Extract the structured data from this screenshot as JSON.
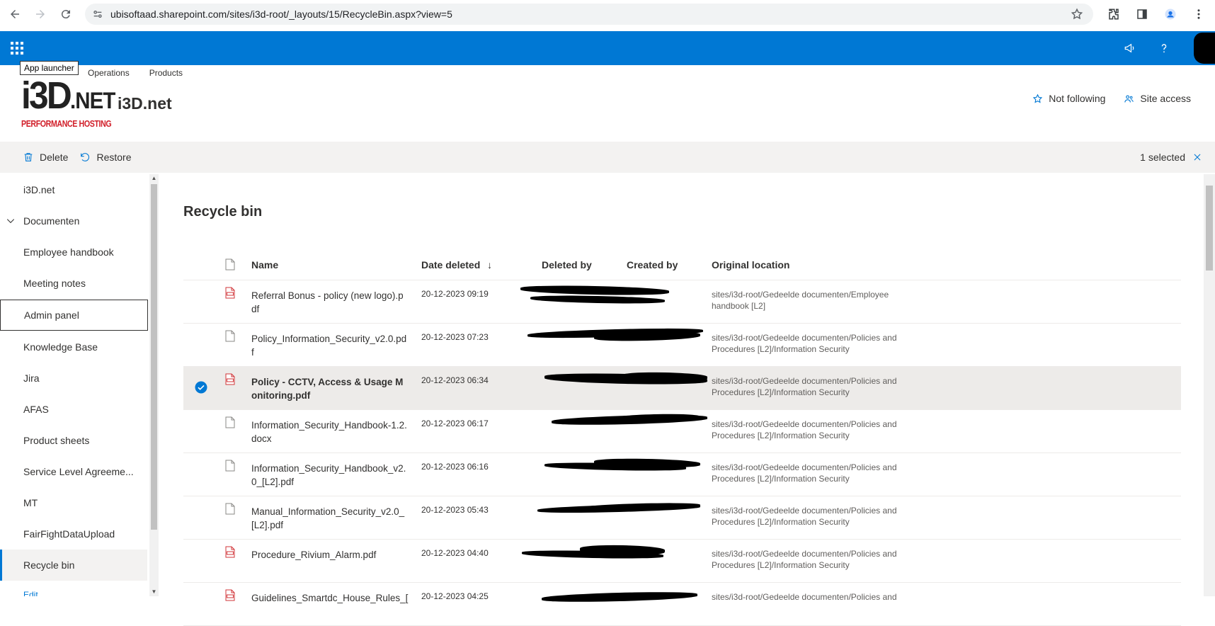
{
  "browser": {
    "url": "ubisoftaad.sharepoint.com/sites/i3d-root/_layouts/15/RecycleBin.aspx?view=5"
  },
  "tooltip": "App launcher",
  "hub_nav": [
    "Operations",
    "Products"
  ],
  "logo": {
    "main": "i3D",
    "suffix": ".NET",
    "tagline": "PERFORMANCE HOSTING"
  },
  "site": {
    "title": "i3D.net",
    "follow_label": "Not following",
    "access_label": "Site access"
  },
  "commands": {
    "delete": "Delete",
    "restore": "Restore",
    "selected": "1 selected"
  },
  "left_nav": [
    "i3D.net",
    "Documenten",
    "Employee handbook",
    "Meeting notes",
    "Admin panel",
    "Knowledge Base",
    "Jira",
    "AFAS",
    "Product sheets",
    "Service Level Agreeme...",
    "MT",
    "FairFightDataUpload",
    "Recycle bin",
    "Edit"
  ],
  "page_title": "Recycle bin",
  "columns": {
    "name": "Name",
    "date_deleted": "Date deleted",
    "sort_arrow": "↓",
    "deleted_by": "Deleted by",
    "created_by": "Created by",
    "original_location": "Original location"
  },
  "rows": [
    {
      "name": "Referral Bonus - policy (new logo).pdf",
      "date": "20-12-2023 09:19",
      "location": "sites/i3d-root/Gedeelde documenten/Employee handbook [L2]",
      "type": "pdf",
      "selected": false
    },
    {
      "name": "Policy_Information_Security_v2.0.pdf",
      "date": "20-12-2023 07:23",
      "location": "sites/i3d-root/Gedeelde documenten/Policies and Procedures [L2]/Information Security",
      "type": "file",
      "selected": false
    },
    {
      "name": "Policy - CCTV, Access & Usage Monitoring.pdf",
      "date": "20-12-2023 06:34",
      "location": "sites/i3d-root/Gedeelde documenten/Policies and Procedures [L2]/Information Security",
      "type": "pdf",
      "selected": true
    },
    {
      "name": "Information_Security_Handbook-1.2.docx",
      "date": "20-12-2023 06:17",
      "location": "sites/i3d-root/Gedeelde documenten/Policies and Procedures [L2]/Information Security",
      "type": "file",
      "selected": false
    },
    {
      "name": "Information_Security_Handbook_v2.0_[L2].pdf",
      "date": "20-12-2023 06:16",
      "location": "sites/i3d-root/Gedeelde documenten/Policies and Procedures [L2]/Information Security",
      "type": "file",
      "selected": false
    },
    {
      "name": "Manual_Information_Security_v2.0_[L2].pdf",
      "date": "20-12-2023 05:43",
      "location": "sites/i3d-root/Gedeelde documenten/Policies and Procedures [L2]/Information Security",
      "type": "file",
      "selected": false
    },
    {
      "name": "Procedure_Rivium_Alarm.pdf",
      "date": "20-12-2023 04:40",
      "location": "sites/i3d-root/Gedeelde documenten/Policies and Procedures [L2]/Information Security",
      "type": "pdf",
      "selected": false
    },
    {
      "name": "Guidelines_Smartdc_House_Rules_[",
      "date": "20-12-2023 04:25",
      "location": "sites/i3d-root/Gedeelde documenten/Policies and",
      "type": "pdf",
      "selected": false
    }
  ],
  "colors": {
    "accent": "#0078d4",
    "logo_red": "#d11f2a",
    "pdf_red": "#d13438"
  }
}
